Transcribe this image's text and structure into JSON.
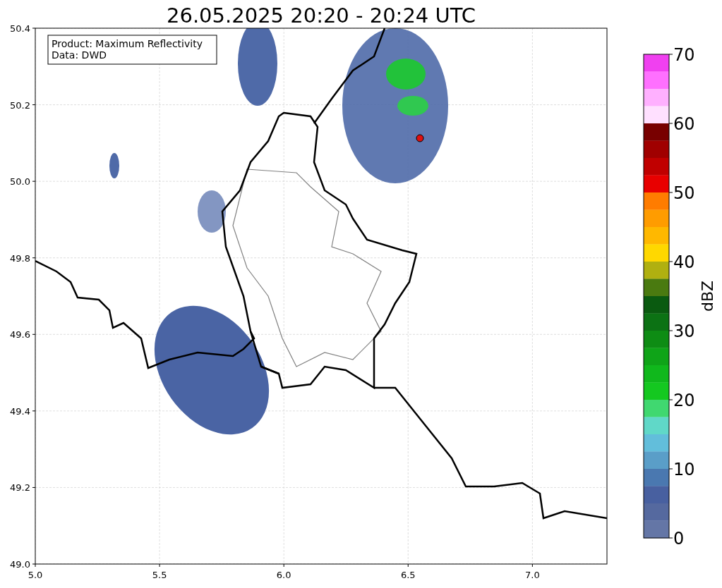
{
  "title": "26.05.2025 20:20 - 20:24 UTC",
  "info_box": {
    "lines": [
      "Product: Maximum Reflectivity",
      "Data: DWD"
    ]
  },
  "map": {
    "xticks": [
      "5.0",
      "5.5",
      "6.0",
      "6.5",
      "7.0"
    ],
    "yticks": [
      "50.4",
      "50.2",
      "50.0",
      "49.8",
      "49.6",
      "49.4",
      "49.2",
      "49.0"
    ]
  },
  "colorbar": {
    "label": "dBZ",
    "ticks": [
      "70",
      "60",
      "50",
      "40",
      "30",
      "20",
      "10",
      "0"
    ],
    "segments": [
      {
        "color": "#f040f0"
      },
      {
        "color": "#ff70ff"
      },
      {
        "color": "#ffb0ff"
      },
      {
        "color": "#ffe0ff"
      },
      {
        "color": "#780000"
      },
      {
        "color": "#a00000"
      },
      {
        "color": "#c00000"
      },
      {
        "color": "#e80000"
      },
      {
        "color": "#ff7c00"
      },
      {
        "color": "#ff9c00"
      },
      {
        "color": "#ffb800"
      },
      {
        "color": "#ffd800"
      },
      {
        "color": "#b0b010"
      },
      {
        "color": "#4a7a10"
      },
      {
        "color": "#0a5a10"
      },
      {
        "color": "#0c7214"
      },
      {
        "color": "#0e8c14"
      },
      {
        "color": "#0fa418"
      },
      {
        "color": "#10b81c"
      },
      {
        "color": "#14c820"
      },
      {
        "color": "#40d870"
      },
      {
        "color": "#60d8c8"
      },
      {
        "color": "#62bedb"
      },
      {
        "color": "#5a9ec8"
      },
      {
        "color": "#4a78b0"
      },
      {
        "color": "#4860a0"
      },
      {
        "color": "#55699f"
      },
      {
        "color": "#6476a6"
      }
    ]
  }
}
